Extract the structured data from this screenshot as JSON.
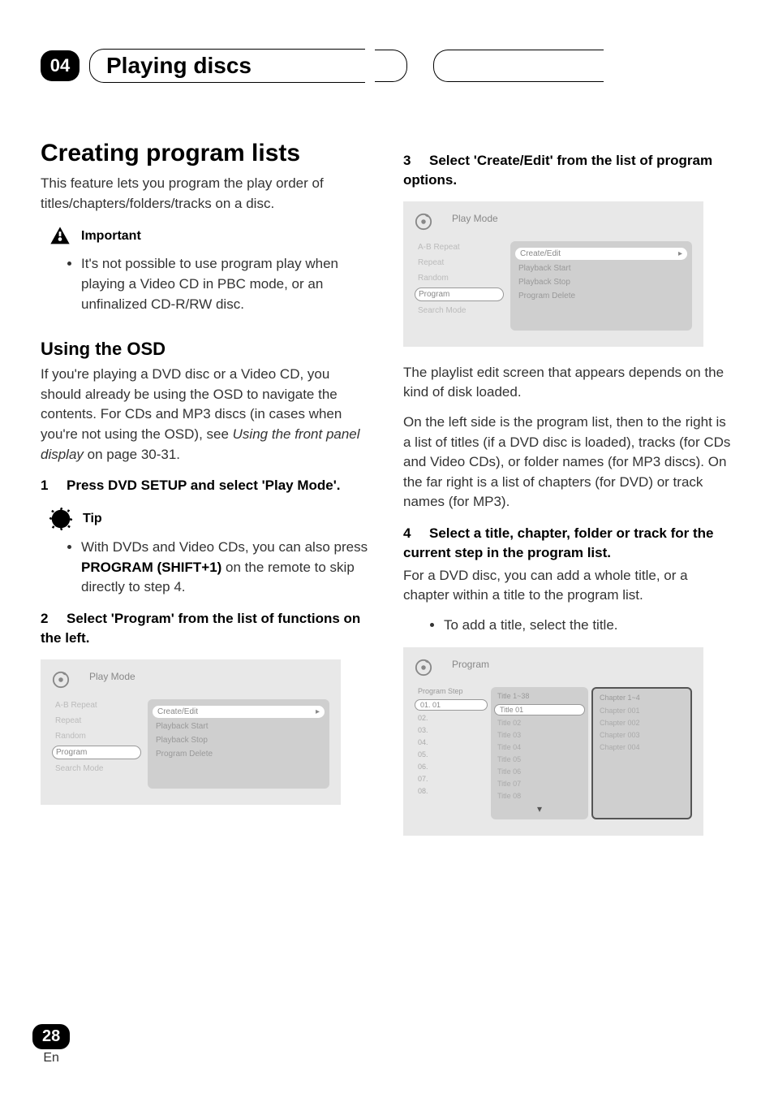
{
  "header": {
    "chapter_number": "04",
    "chapter_title": "Playing discs"
  },
  "left": {
    "h1": "Creating program lists",
    "intro": "This feature lets you program the play order of titles/chapters/folders/tracks on a disc.",
    "important_label": "Important",
    "important_bullet": "It's not possible to use program play when playing a Video CD in PBC mode, or an unfinalized CD-R/RW disc.",
    "h2": "Using the OSD",
    "osd_intro_1": "If you're playing a DVD disc or a Video CD, you should already be using the OSD to navigate the contents. For CDs and MP3 discs (in cases when you're not using the OSD), see ",
    "osd_intro_italic": "Using the front panel display",
    "osd_intro_2": " on page 30-31.",
    "step1_num": "1",
    "step1_text": "Press DVD SETUP and select 'Play Mode'.",
    "tip_label": "Tip",
    "tip_bullet_pre": "With DVDs and Video CDs, you can also press ",
    "tip_bullet_bold": "PROGRAM (SHIFT+1)",
    "tip_bullet_post": " on the remote to skip directly to step 4.",
    "step2_num": "2",
    "step2_text": "Select 'Program' from the list of functions on the left.",
    "osd2": {
      "top_label": "Play Mode",
      "left_items": [
        "A-B Repeat",
        "Repeat",
        "Random",
        "Program",
        "Search Mode"
      ],
      "left_selected_index": 3,
      "right_items": [
        "Create/Edit",
        "Playback Start",
        "Playback Stop",
        "Program Delete"
      ],
      "right_selected_index": 0
    }
  },
  "right": {
    "step3_num": "3",
    "step3_text": "Select 'Create/Edit' from the list of program options.",
    "osd3": {
      "top_label": "Play Mode",
      "left_items": [
        "A-B Repeat",
        "Repeat",
        "Random",
        "Program",
        "Search Mode"
      ],
      "left_selected_index": 3,
      "right_items": [
        "Create/Edit",
        "Playback Start",
        "Playback Stop",
        "Program Delete"
      ],
      "right_selected_index": 0
    },
    "after3_p1": "The playlist edit screen that appears depends on the kind of disk loaded.",
    "after3_p2": "On the left side is the program list, then to the right is a list of titles (if a DVD disc is loaded), tracks (for CDs and Video CDs), or folder names (for MP3 discs). On the far right is a list of chapters (for DVD) or track names (for MP3).",
    "step4_num": "4",
    "step4_text": "Select a title, chapter, folder or track for the current step in the program list.",
    "step4_body": "For a DVD disc, you can add a whole title, or a chapter within a title to the program list.",
    "step4_bullet": "To add a title, select the title.",
    "osd4": {
      "top_label": "Program",
      "prog_header": "Program Step",
      "prog_items": [
        "01. 01",
        "02.",
        "03.",
        "04.",
        "05.",
        "06.",
        "07.",
        "08."
      ],
      "title_header": "Title 1~38",
      "title_items": [
        "Title 01",
        "Title 02",
        "Title 03",
        "Title 04",
        "Title 05",
        "Title 06",
        "Title 07",
        "Title 08"
      ],
      "title_selected_index": 0,
      "chap_header": "Chapter 1~4",
      "chap_items": [
        "Chapter 001",
        "Chapter 002",
        "Chapter 003",
        "Chapter 004"
      ]
    }
  },
  "footer": {
    "page_number": "28",
    "lang": "En"
  }
}
